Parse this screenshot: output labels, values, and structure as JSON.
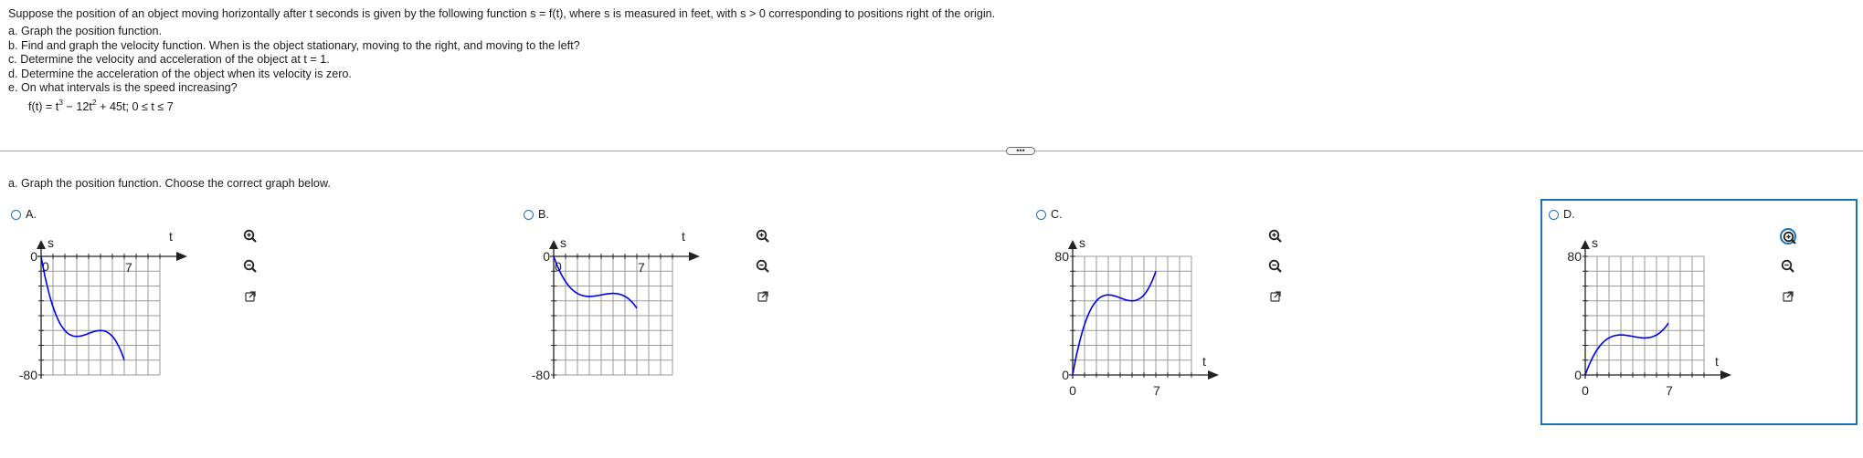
{
  "problem": {
    "intro": "Suppose the position of an object moving horizontally after t seconds is given by the following function s = f(t), where s is measured in feet, with s > 0 corresponding to positions right of the origin.",
    "parts": [
      "a. Graph the position function.",
      "b. Find and graph the velocity function. When is the object stationary, moving to the right, and moving to the left?",
      "c. Determine the velocity and acceleration of the object at t = 1.",
      "d. Determine the acceleration of the object when its velocity is zero.",
      "e. On what intervals is the speed increasing?"
    ],
    "function": {
      "lhs": "f(t) = t",
      "exp1": "3",
      "mid": " − 12t",
      "exp2": "2",
      "rest": " + 45t; 0 ≤ t ≤ 7"
    }
  },
  "expand_label": "•••",
  "question": "a. Graph the position function. Choose the correct graph below.",
  "options": [
    {
      "letter": "A.",
      "selected": false,
      "graph": {
        "axis_label_s": "s",
        "axis_label_t": "t",
        "tick_top": "0",
        "tick_bottom": "-80",
        "origin_label": "0",
        "t_end_label": "7"
      }
    },
    {
      "letter": "B.",
      "selected": false,
      "graph": {
        "axis_label_s": "s",
        "axis_label_t": "t",
        "tick_top": "0",
        "tick_bottom": "-80",
        "origin_label": "0",
        "t_end_label": "7"
      }
    },
    {
      "letter": "C.",
      "selected": false,
      "graph": {
        "axis_label_s": "s",
        "axis_label_t": "t",
        "tick_top": "80",
        "tick_bottom": "0",
        "origin_label": "0",
        "t_end_label": "7"
      }
    },
    {
      "letter": "D.",
      "selected": true,
      "graph": {
        "axis_label_s": "s",
        "axis_label_t": "t",
        "tick_top": "80",
        "tick_bottom": "0",
        "origin_label": "0",
        "t_end_label": "7"
      }
    }
  ],
  "icons": {
    "zoom_in": "zoom-in-icon",
    "zoom_out": "zoom-out-icon",
    "open_new": "open-in-new-window-icon"
  },
  "colors": {
    "accent": "#1e70b9",
    "curve": "#0000ee",
    "grid": "#9a9a9a",
    "divider": "#a8a8a8"
  }
}
